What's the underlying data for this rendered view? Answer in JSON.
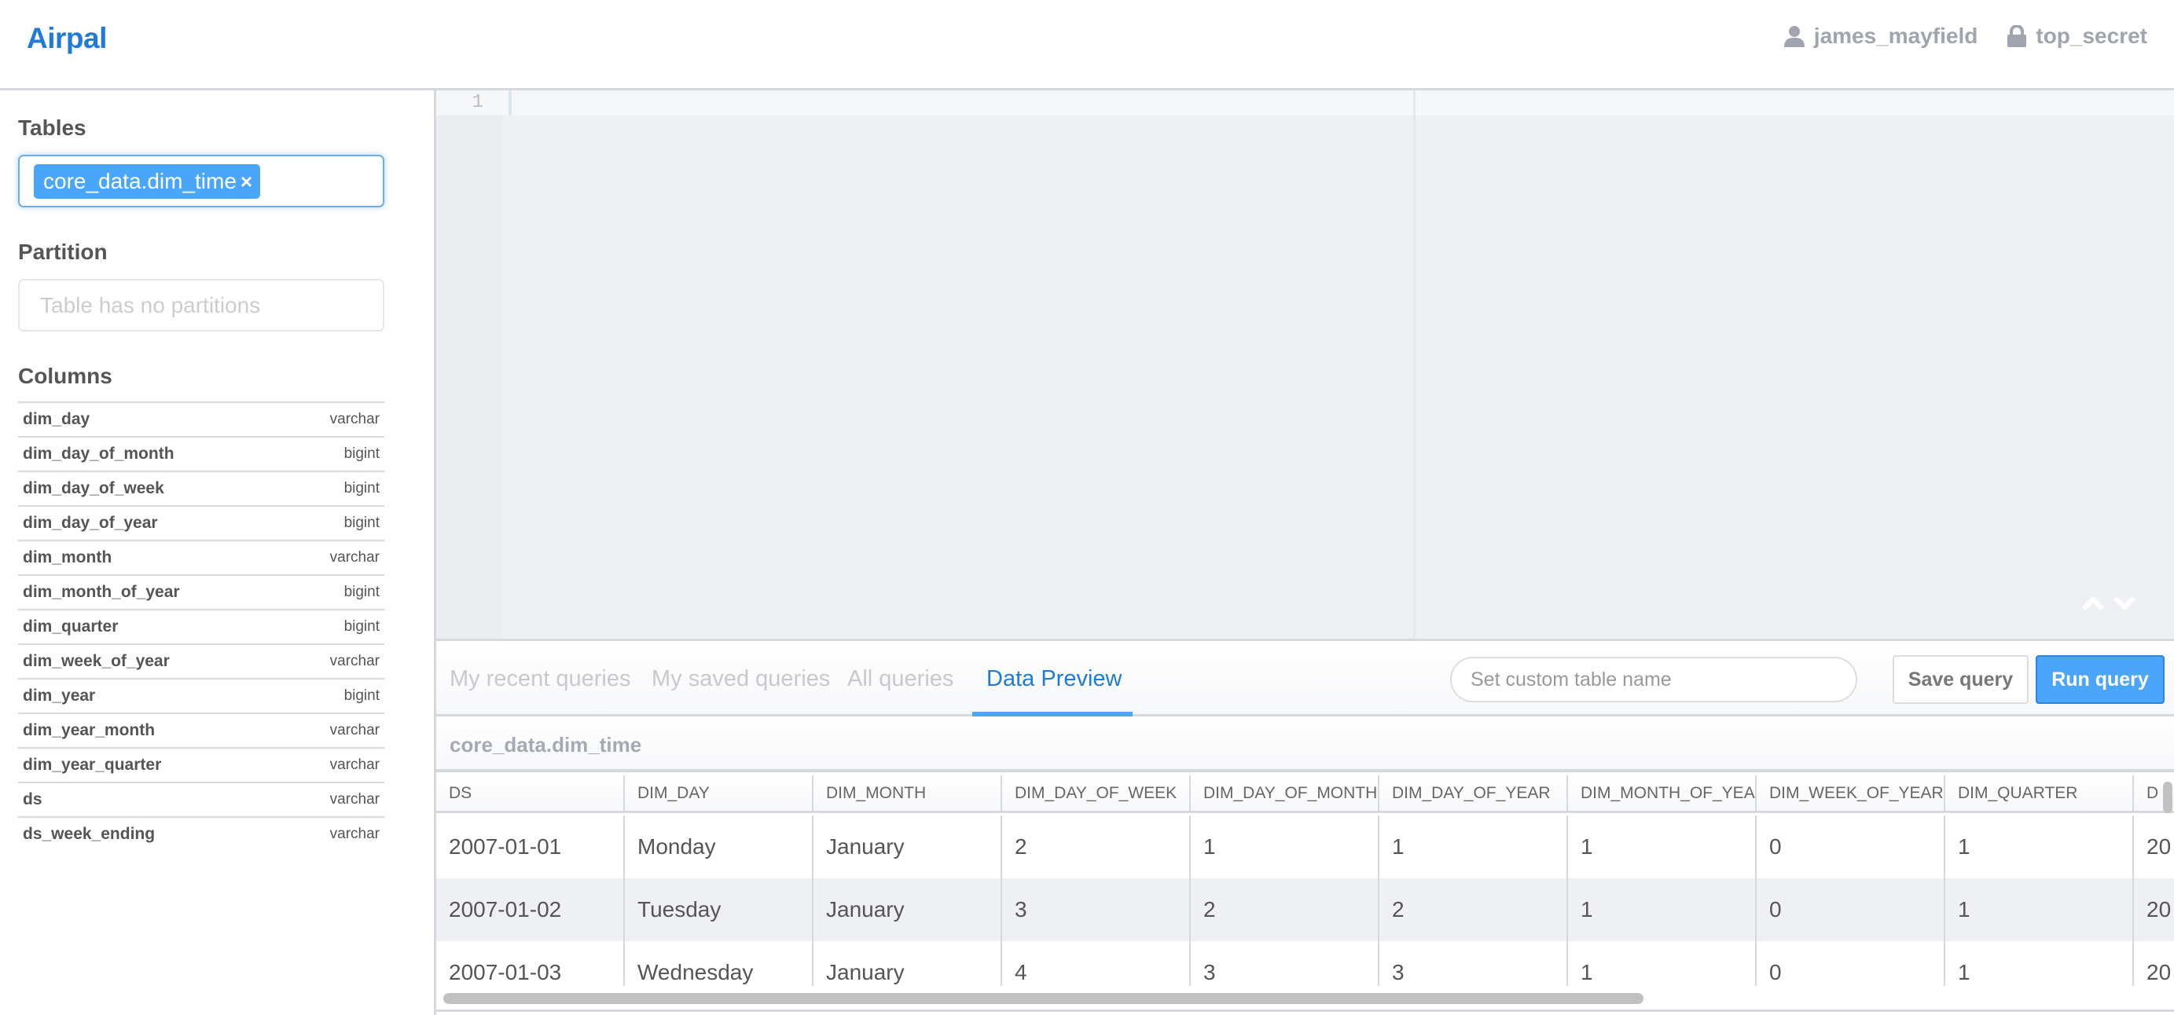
{
  "header": {
    "app_name": "Airpal",
    "username": "james_mayfield",
    "user_icon": "user-icon",
    "access_level": "top_secret",
    "access_icon": "lock-icon"
  },
  "sidebar": {
    "tables_label": "Tables",
    "selected_table": "core_data.dim_time",
    "remove_tag_label": "×",
    "partition_label": "Partition",
    "partition_placeholder": "Table has no partitions",
    "columns_label": "Columns",
    "columns": [
      {
        "name": "dim_day",
        "type": "varchar"
      },
      {
        "name": "dim_day_of_month",
        "type": "bigint"
      },
      {
        "name": "dim_day_of_week",
        "type": "bigint"
      },
      {
        "name": "dim_day_of_year",
        "type": "bigint"
      },
      {
        "name": "dim_month",
        "type": "varchar"
      },
      {
        "name": "dim_month_of_year",
        "type": "bigint"
      },
      {
        "name": "dim_quarter",
        "type": "bigint"
      },
      {
        "name": "dim_week_of_year",
        "type": "varchar"
      },
      {
        "name": "dim_year",
        "type": "bigint"
      },
      {
        "name": "dim_year_month",
        "type": "varchar"
      },
      {
        "name": "dim_year_quarter",
        "type": "varchar"
      },
      {
        "name": "ds",
        "type": "varchar"
      },
      {
        "name": "ds_week_ending",
        "type": "varchar"
      }
    ]
  },
  "editor": {
    "line_numbers": [
      "1"
    ],
    "content": "",
    "fold_icons": [
      "chevron-up-icon",
      "chevron-down-icon"
    ]
  },
  "tabs": [
    {
      "label": "My recent queries",
      "active": false
    },
    {
      "label": "My saved queries",
      "active": false
    },
    {
      "label": "All queries",
      "active": false
    },
    {
      "label": "Data Preview",
      "active": true
    }
  ],
  "actions": {
    "custom_table_placeholder": "Set custom table name",
    "save_label": "Save query",
    "run_label": "Run query"
  },
  "preview": {
    "table_name": "core_data.dim_time",
    "columns": [
      "DS",
      "DIM_DAY",
      "DIM_MONTH",
      "DIM_DAY_OF_WEEK",
      "DIM_DAY_OF_MONTH",
      "DIM_DAY_OF_YEAR",
      "DIM_MONTH_OF_YEAR",
      "DIM_WEEK_OF_YEAR",
      "DIM_QUARTER",
      "D"
    ],
    "rows": [
      [
        "2007-01-01",
        "Monday",
        "January",
        "2",
        "1",
        "1",
        "1",
        "0",
        "1",
        "20"
      ],
      [
        "2007-01-02",
        "Tuesday",
        "January",
        "3",
        "2",
        "2",
        "1",
        "0",
        "1",
        "20"
      ],
      [
        "2007-01-03",
        "Wednesday",
        "January",
        "4",
        "3",
        "3",
        "1",
        "0",
        "1",
        "20"
      ]
    ]
  },
  "colors": {
    "accent": "#1f7bd6",
    "button_primary": "#4aa6fb",
    "muted_text": "#9fa4ae"
  }
}
